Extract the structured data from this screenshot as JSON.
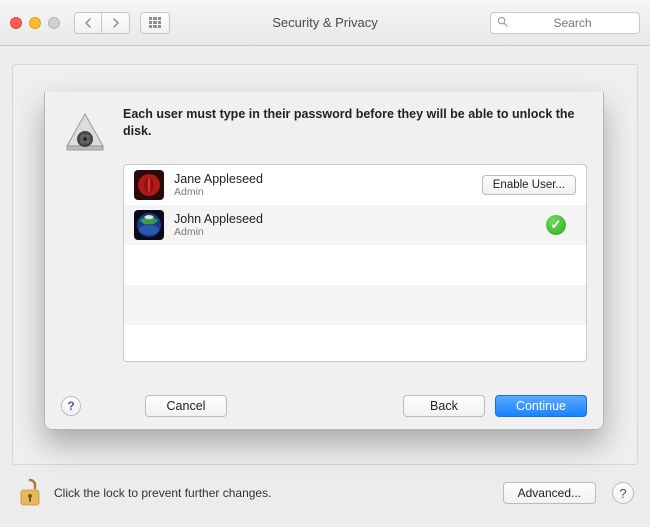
{
  "header": {
    "title": "Security & Privacy",
    "search_placeholder": "Search"
  },
  "sheet": {
    "message": "Each user must type in their password before they will be able to unlock the disk.",
    "users": [
      {
        "name": "Jane Appleseed",
        "role": "Admin",
        "status": "disabled",
        "action_label": "Enable User..."
      },
      {
        "name": "John Appleseed",
        "role": "Admin",
        "status": "enabled"
      }
    ],
    "buttons": {
      "cancel": "Cancel",
      "back": "Back",
      "continue": "Continue"
    }
  },
  "footer": {
    "lock_text": "Click the lock to prevent further changes.",
    "advanced": "Advanced...",
    "help": "?"
  }
}
